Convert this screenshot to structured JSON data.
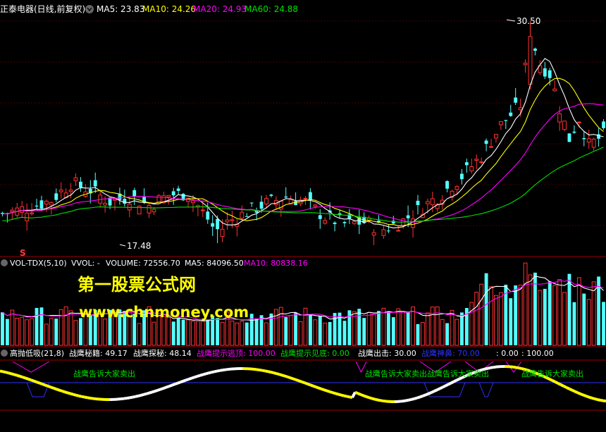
{
  "header": {
    "title": "正泰电器(日线,前复权)",
    "ma5": "MA5: 23.83",
    "ma10": "MA10: 24.26",
    "ma20": "MA20: 24.93",
    "ma60": "MA60: 24.88"
  },
  "vol_header": {
    "name": "VOL-TDX(5,10)",
    "vvol": "VVOL: -",
    "volume": "VOLUME: 72556.70",
    "ma5": "MA5: 84096.50",
    "ma10": "MA10: 80838.16"
  },
  "ind_header": {
    "name": "高抛低吸(21,8)",
    "v1": "战鹰秘籍: 49.17",
    "v2": "战鹰探秘: 48.14",
    "v3": "战鹰提示逃顶: 100.00",
    "v4": "战鹰提示见底: 0.00",
    "v5": "战鹰出击: 30.00",
    "v6": "战鹰神鼻: 70.00",
    "v7": ": 0.00",
    "v8": ": 100.00"
  },
  "watermark": {
    "line1": "第一股票公式网",
    "line2": "www.chnmoney.com"
  },
  "annotations": {
    "high": "30.50",
    "low": "17.48",
    "s_marker": "S",
    "sell1": "战鹰告诉大家卖出",
    "sell2": "战鹰告诉大家卖出",
    "sell3": "战鹰告诉大家卖出",
    "sell4": "战鹰告诉大家卖出",
    "sell5": "战鹰告诉大家卖出"
  },
  "colors": {
    "up": "#ff3232",
    "down": "#54ffff",
    "ma5": "#ffffff",
    "ma10": "#ffff00",
    "ma20": "#ff00ff",
    "ma60": "#00e000",
    "grid": "#8b0000",
    "blue_line": "#3030ff"
  },
  "chart_data": {
    "type": "candlestick",
    "anchors": [
      {
        "i": 18,
        "high": 21.2
      },
      {
        "i": 44,
        "low": 17.48
      },
      {
        "i": 108,
        "high": 30.5
      }
    ]
  }
}
